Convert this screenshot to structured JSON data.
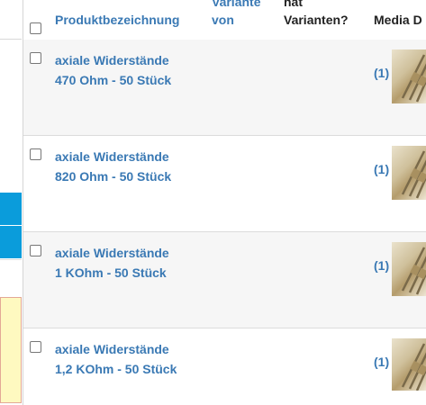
{
  "header": {
    "product_name": "Produktbezeichnung",
    "variant_of_line1": "Variante",
    "variant_of_line2": "von",
    "has_variants_line1": "hat",
    "has_variants_line2": "Varianten?",
    "media": "Media D"
  },
  "rows": [
    {
      "name_line1": "axiale Widerstände",
      "name_line2": "470 Ohm - 50 Stück",
      "media_count": "(1)"
    },
    {
      "name_line1": "axiale Widerstände",
      "name_line2": "820 Ohm - 50 Stück",
      "media_count": "(1)"
    },
    {
      "name_line1": "axiale Widerstände",
      "name_line2": "1 KOhm - 50 Stück",
      "media_count": "(1)"
    },
    {
      "name_line1": "axiale Widerstände",
      "name_line2": "1,2 KOhm - 50 Stück",
      "media_count": "(1)"
    }
  ],
  "colors": {
    "link": "#3a79b4",
    "sidebar_active": "#0a9cdb",
    "highlight": "#fef9c0"
  }
}
